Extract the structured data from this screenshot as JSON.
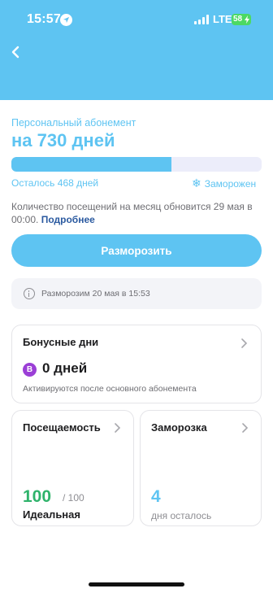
{
  "status_bar": {
    "time": "15:57",
    "network": "LTE",
    "battery": "58"
  },
  "subscription": {
    "subtitle": "Персональный абонемент",
    "title": "на 730 дней",
    "progress_fraction": 0.64,
    "remaining": "Осталось 468 дней",
    "frozen_status": "Заморожен",
    "note": "Количество посещений на месяц обновится 29 мая в 00:00.",
    "more_link": "Подробнее"
  },
  "unfreeze_button": "Разморозить",
  "info": {
    "text": "Разморозим 20 мая в 15:53"
  },
  "bonus": {
    "title": "Бонусные дни",
    "badge": "B",
    "value": "0 дней",
    "caption": "Активируются после основного абонемента"
  },
  "attendance": {
    "title": "Посещаемость",
    "value": "100",
    "of": "/ 100",
    "label": "Идеальная"
  },
  "freeze": {
    "title": "Заморозка",
    "value": "4",
    "label": "дня осталось"
  },
  "colors": {
    "accent": "#5ec4f2",
    "green": "#2fb36b",
    "purple": "#9b3fd6",
    "link": "#2b5aa0"
  }
}
